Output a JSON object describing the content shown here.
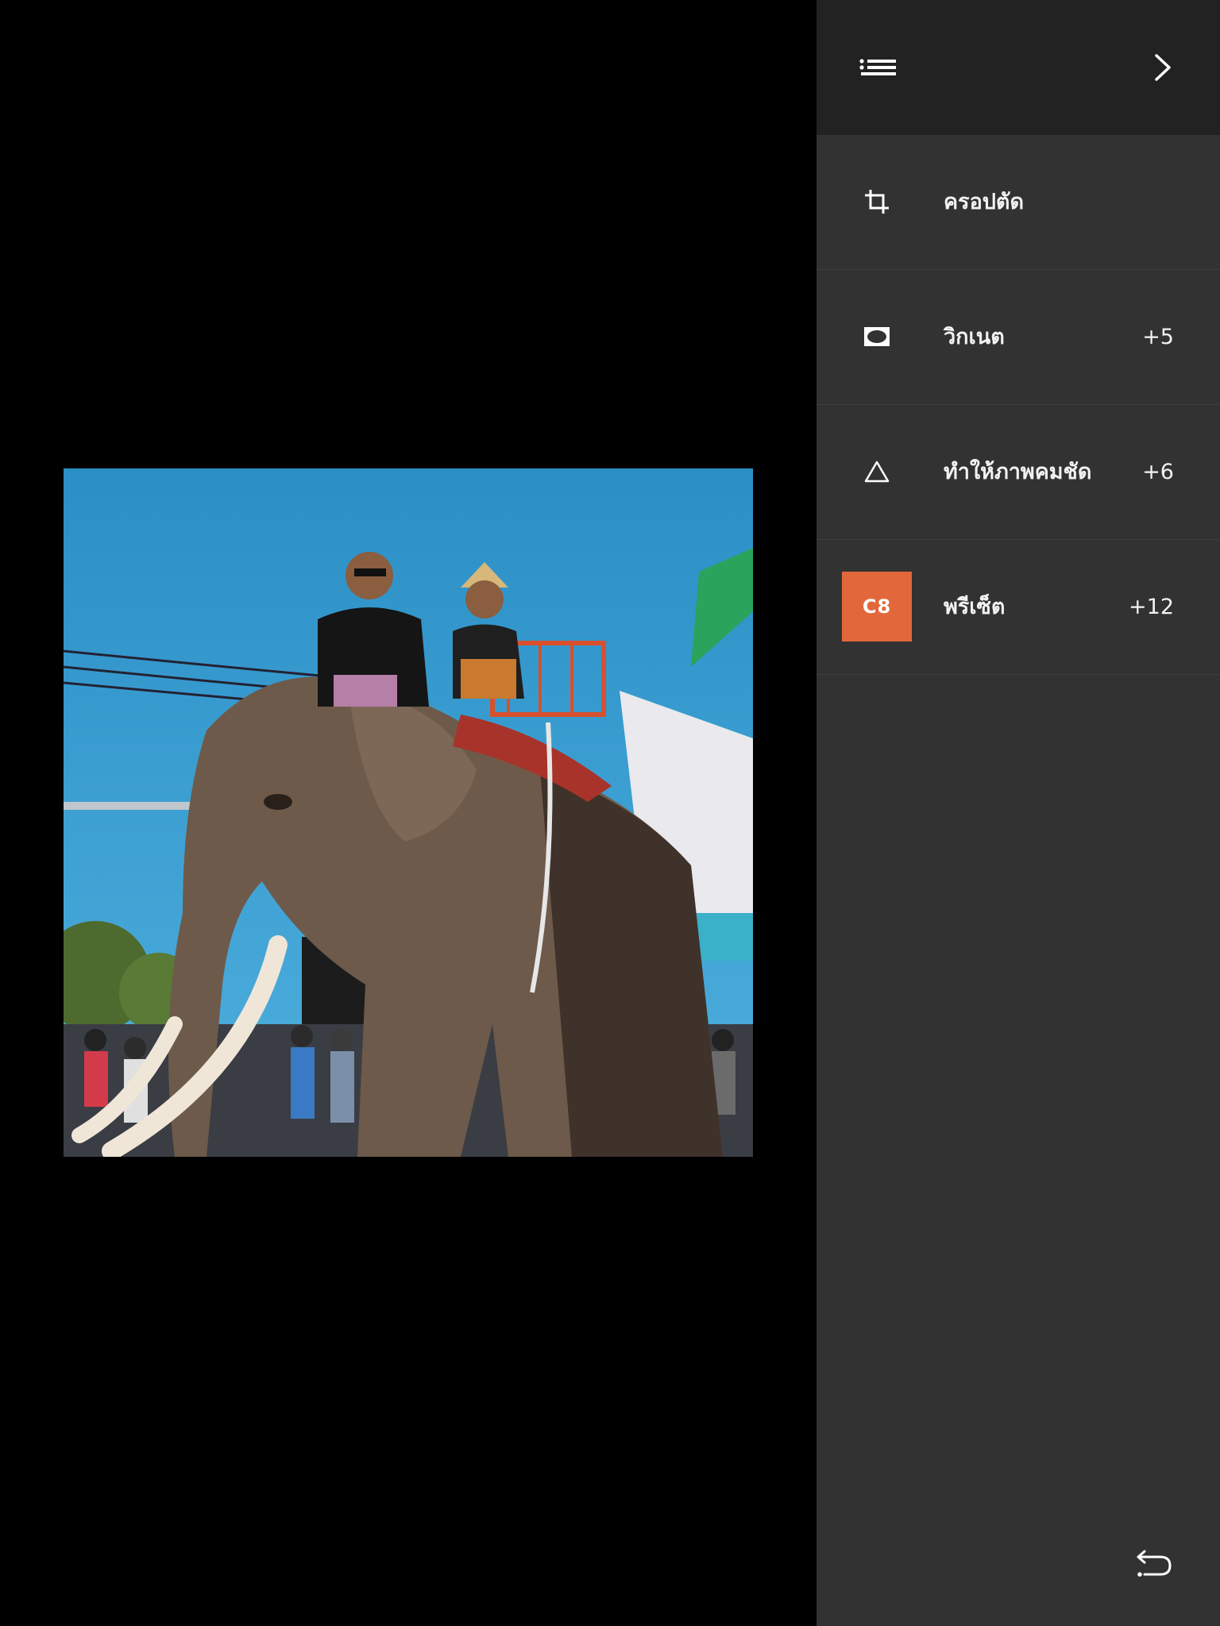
{
  "theme": {
    "canvas_bg": "#000000",
    "panel_bg": "#323232",
    "header_bg": "#222222",
    "text": "#f2f2f2",
    "preset_accent": "#e2683b"
  },
  "header": {
    "list_icon": "list-icon",
    "next_icon": "chevron-right-icon"
  },
  "tools": [
    {
      "label": "ครอปตัด",
      "value": "",
      "icon": "crop-icon"
    },
    {
      "label": "วิกเนต",
      "value": "+5",
      "icon": "vignette-icon"
    },
    {
      "label": "ทำให้ภาพคมชัด",
      "value": "+6",
      "icon": "sharpen-icon"
    },
    {
      "label": "พรีเซ็ต",
      "value": "+12",
      "icon": "preset-badge",
      "badge": "C8"
    }
  ],
  "footer": {
    "undo_icon": "undo-icon"
  }
}
